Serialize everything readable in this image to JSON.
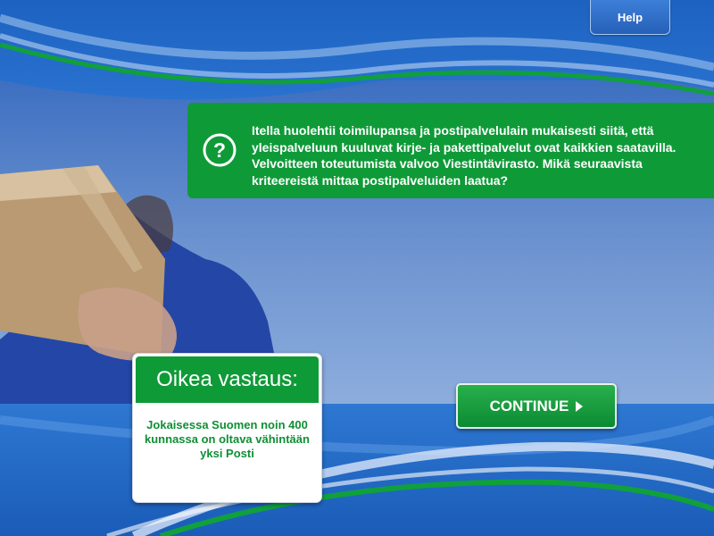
{
  "header": {
    "help_label": "Help"
  },
  "question": {
    "icon": "question-mark-icon",
    "text": "Itella huolehtii toimilupansa ja postipalvelulain mukaisesti siitä, että yleispalveluun kuuluvat kirje- ja pakettipalvelut ovat kaikkien saatavilla. Velvoitteen toteutumista valvoo Viestintävirasto. Mikä seuraavista kriteereistä mittaa postipalveluiden laatua?"
  },
  "answer": {
    "title": "Oikea vastaus:",
    "text": "Jokaisessa Suomen noin 400 kunnassa on oltava vähintään yksi Posti"
  },
  "continue": {
    "label": "CONTINUE",
    "icon": "play-arrow-icon"
  },
  "colors": {
    "brand_green": "#0f9a38",
    "background_blue": "#2a6fc9",
    "sky": "#7a9fd6"
  }
}
